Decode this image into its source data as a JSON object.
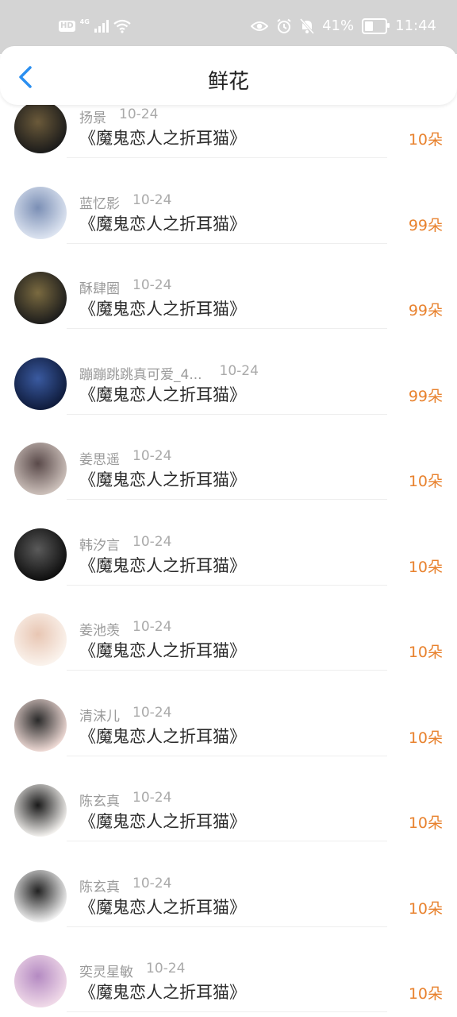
{
  "status_bar": {
    "left_badges": [
      "HD",
      "4G"
    ],
    "battery_percent_text": "41%",
    "battery_level": 0.41,
    "time": "11:44",
    "icons": [
      "hd-icon",
      "signal-icon",
      "wifi-icon",
      "eye-icon",
      "alarm-icon",
      "mute-bell-icon",
      "battery-icon"
    ]
  },
  "header": {
    "title": "鲜花",
    "back_icon": "chevron-left-icon"
  },
  "colors": {
    "accent": "#2b8ff0",
    "amount": "#e8822e",
    "name": "#9a9a9a"
  },
  "rows": [
    {
      "name": "扬景",
      "date": "10-24",
      "book": "《魔鬼恋人之折耳猫》",
      "amount": "10朵"
    },
    {
      "name": "蓝忆影",
      "date": "10-24",
      "book": "《魔鬼恋人之折耳猫》",
      "amount": "99朵"
    },
    {
      "name": "酥肆圈",
      "date": "10-24",
      "book": "《魔鬼恋人之折耳猫》",
      "amount": "99朵"
    },
    {
      "name": "蹦蹦跳跳真可爱_4...",
      "date": "10-24",
      "book": "《魔鬼恋人之折耳猫》",
      "amount": "99朵"
    },
    {
      "name": "姜思遥",
      "date": "10-24",
      "book": "《魔鬼恋人之折耳猫》",
      "amount": "10朵"
    },
    {
      "name": "韩汐言",
      "date": "10-24",
      "book": "《魔鬼恋人之折耳猫》",
      "amount": "10朵"
    },
    {
      "name": "姜池羡",
      "date": "10-24",
      "book": "《魔鬼恋人之折耳猫》",
      "amount": "10朵"
    },
    {
      "name": "清沫儿",
      "date": "10-24",
      "book": "《魔鬼恋人之折耳猫》",
      "amount": "10朵"
    },
    {
      "name": "陈玄真",
      "date": "10-24",
      "book": "《魔鬼恋人之折耳猫》",
      "amount": "10朵"
    },
    {
      "name": "陈玄真",
      "date": "10-24",
      "book": "《魔鬼恋人之折耳猫》",
      "amount": "10朵"
    },
    {
      "name": "奕灵星敏",
      "date": "10-24",
      "book": "《魔鬼恋人之折耳猫》",
      "amount": "10朵"
    }
  ]
}
